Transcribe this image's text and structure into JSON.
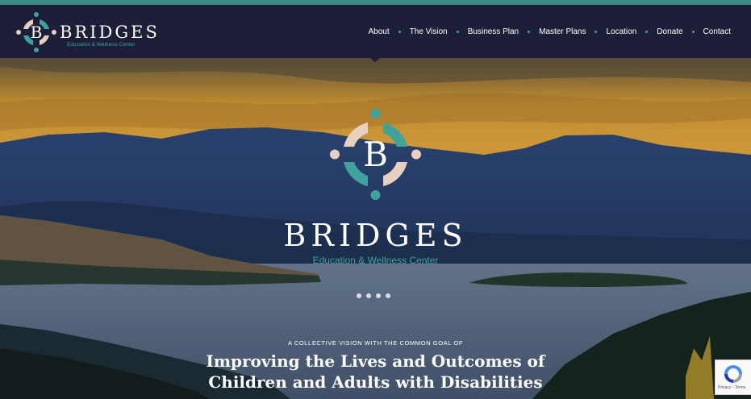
{
  "brand": {
    "name": "BRIDGES",
    "tagline": "Education & Wellness Center",
    "letter": "B"
  },
  "nav": {
    "items": [
      "About",
      "The Vision",
      "Business Plan",
      "Master Plans",
      "Location",
      "Donate",
      "Contact"
    ]
  },
  "hero": {
    "title": "BRIDGES",
    "subtitle": "Education & Wellness Center",
    "slide_count": 4,
    "kicker": "A COLLECTIVE VISION WITH THE COMMON GOAL OF",
    "headline_line1": "Improving the Lives and Outcomes of",
    "headline_line2": "Children and Adults with Disabilities"
  },
  "recaptcha": {
    "text": "Privacy - Terms"
  },
  "colors": {
    "navy": "#1c1f37",
    "teal": "#3fa29c",
    "peach": "#e8d0c0",
    "white": "#ffffff"
  }
}
